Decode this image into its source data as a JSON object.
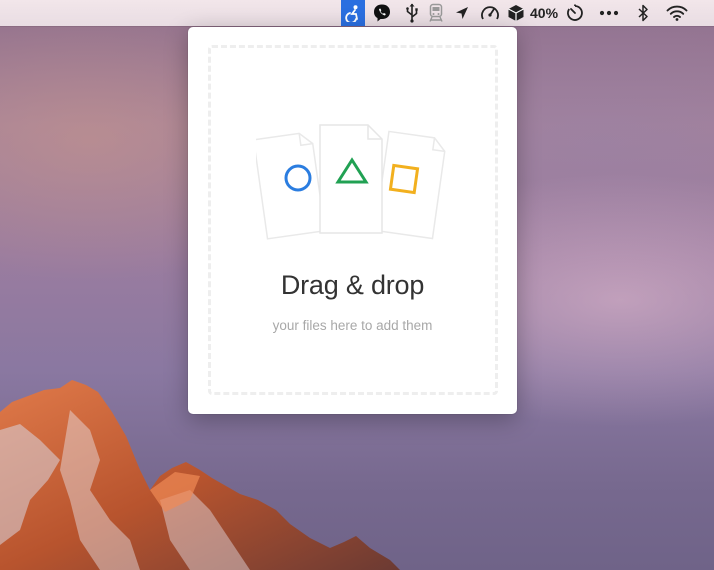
{
  "menubar": {
    "battery_percent": "40%",
    "icons": [
      "accessibility-app-icon",
      "viber-icon",
      "usb-icon",
      "train-icon",
      "location-arrow-icon",
      "speedometer-icon",
      "package-icon",
      "battery-icon",
      "timer-icon",
      "more-icon",
      "bluetooth-icon",
      "wifi-icon"
    ],
    "active_color": "#2a6fe0"
  },
  "dropzone": {
    "title": "Drag & drop",
    "subtitle": "your files here to add them",
    "shape_colors": {
      "circle": "#2b7de0",
      "triangle": "#21a153",
      "square": "#f2b01e"
    }
  }
}
